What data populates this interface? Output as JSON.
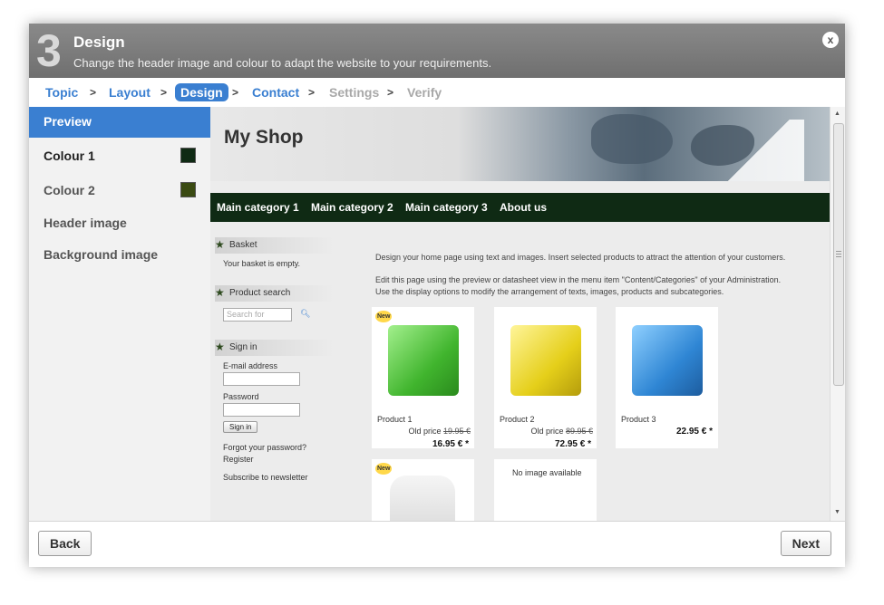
{
  "header": {
    "step_number": "3",
    "title": "Design",
    "subtitle": "Change the header image and colour to adapt the website to your requirements.",
    "close_label": "x"
  },
  "breadcrumb": {
    "separator": ">",
    "items": [
      {
        "label": "Topic",
        "state": "link"
      },
      {
        "label": "Layout",
        "state": "link"
      },
      {
        "label": "Design",
        "state": "active"
      },
      {
        "label": "Contact",
        "state": "link"
      },
      {
        "label": "Settings",
        "state": "disabled"
      },
      {
        "label": "Verify",
        "state": "disabled"
      }
    ]
  },
  "sidebar": {
    "items": [
      {
        "label": "Preview"
      },
      {
        "label": "Colour 1",
        "swatch": "#0f2a14"
      },
      {
        "label": "Colour 2",
        "swatch": "#3a4a12"
      },
      {
        "label": "Header image"
      },
      {
        "label": "Background image"
      }
    ]
  },
  "preview": {
    "shop_title": "My Shop",
    "nav": [
      "Main category 1",
      "Main category 2",
      "Main category 3",
      "About us"
    ],
    "basket": {
      "title": "Basket",
      "text": "Your basket is empty."
    },
    "search": {
      "title": "Product search",
      "placeholder": "Search for",
      "icon": "magnifier-icon"
    },
    "signin": {
      "title": "Sign in",
      "email_label": "E-mail address",
      "password_label": "Password",
      "button": "Sign in",
      "forgot": "Forgot your password?",
      "register": "Register",
      "newsletter": "Subscribe to newsletter"
    },
    "intro_1": "Design your home page using text and images. Insert selected products to attract the attention of your customers.",
    "intro_2": "Edit this page using the preview or datasheet view in the menu item \"Content/Categories\" of your Administration.",
    "intro_3": "Use the display options to modify the arrangement of texts, images, products and subcategories.",
    "products": [
      {
        "name": "Product 1",
        "old_label": "Old price",
        "old_price": "19.95 €",
        "price": "16.95 € *",
        "badge": "New",
        "color": "#4cc436"
      },
      {
        "name": "Product 2",
        "old_label": "Old price",
        "old_price": "89.95 €",
        "price": "72.95 € *",
        "badge": "",
        "color": "#e8d21e"
      },
      {
        "name": "Product 3",
        "old_label": "",
        "old_price": "",
        "price": "22.95 € *",
        "badge": "",
        "color": "#2f86d4"
      }
    ],
    "row2": {
      "badge": "New",
      "no_image": "No image available"
    }
  },
  "footer": {
    "back_label": "Back",
    "next_label": "Next"
  },
  "colors": {
    "accent": "#3a7fd1",
    "nav_bg": "#0f2a14"
  }
}
